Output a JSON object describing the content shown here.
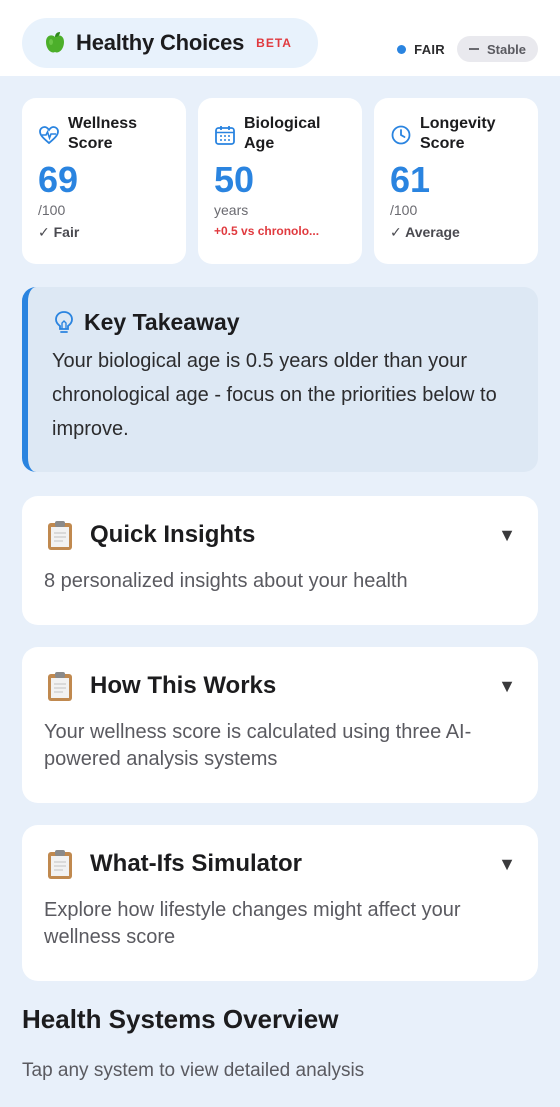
{
  "header": {
    "app_name": "Healthy Choices",
    "beta_label": "BETA",
    "status_label": "FAIR",
    "trend_label": "Stable"
  },
  "metrics": [
    {
      "title": "Wellness Score",
      "value": "69",
      "unit": "/100",
      "note": "✓ Fair"
    },
    {
      "title": "Biological Age",
      "value": "50",
      "unit": "years",
      "note": "+0.5 vs chronolo..."
    },
    {
      "title": "Longevity Score",
      "value": "61",
      "unit": "/100",
      "note": "✓ Average"
    }
  ],
  "takeaway": {
    "title": "Key Takeaway",
    "body": "Your biological age is 0.5 years older than your chronological age - focus on the priorities below to improve."
  },
  "cards": [
    {
      "title": "Quick Insights",
      "body": "8 personalized insights about your health",
      "chevron": "▼"
    },
    {
      "title": "How This Works",
      "body": "Your wellness score is calculated using three AI-powered analysis systems",
      "chevron": "▼"
    },
    {
      "title": "What-Ifs Simulator",
      "body": "Explore how lifestyle changes might affect your wellness score",
      "chevron": "▼"
    }
  ],
  "overview": {
    "title": "Health Systems Overview",
    "subtitle": "Tap any system to view detailed analysis"
  },
  "colors": {
    "accent": "#2a84e0",
    "warning": "#e0393e",
    "background": "#e8f0fa"
  },
  "icons": {
    "brand": "apple-icon",
    "wellness": "heart-pulse-icon",
    "bio_age": "calendar-icon",
    "longevity": "clock-icon",
    "takeaway": "lightbulb-icon",
    "cards": "clipboard-icon"
  }
}
